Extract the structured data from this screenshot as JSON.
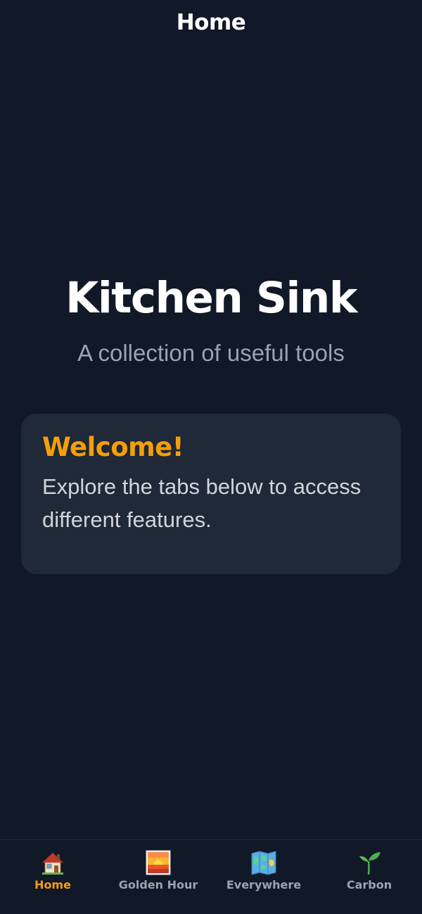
{
  "header": {
    "title": "Home"
  },
  "hero": {
    "title": "Kitchen Sink",
    "subtitle": "A collection of useful tools"
  },
  "card": {
    "title": "Welcome!",
    "text": "Explore the tabs below to access different features."
  },
  "tabs": [
    {
      "label": "Home",
      "icon": "house-icon",
      "active": true
    },
    {
      "label": "Golden Hour",
      "icon": "sunrise-icon",
      "active": false
    },
    {
      "label": "Everywhere",
      "icon": "map-icon",
      "active": false
    },
    {
      "label": "Carbon",
      "icon": "seedling-icon",
      "active": false
    }
  ],
  "colors": {
    "background": "#111827",
    "card": "#1f2937",
    "accent": "#f59e0b",
    "muted": "#9ca3af"
  }
}
